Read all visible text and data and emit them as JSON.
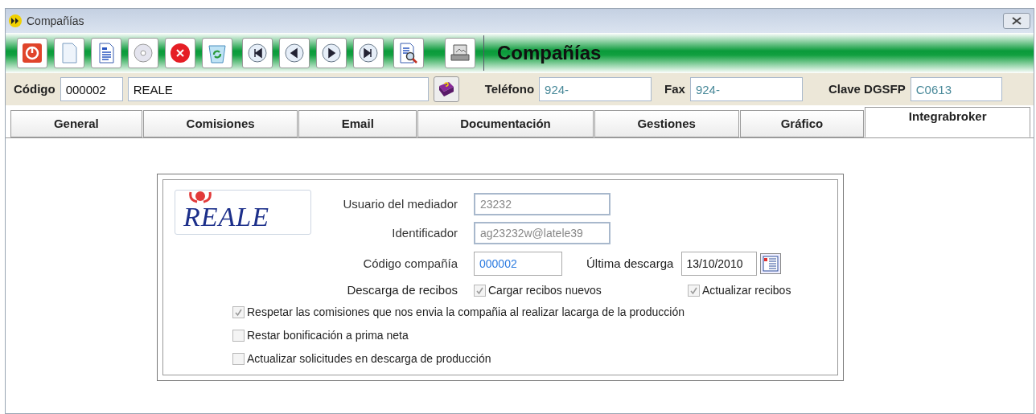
{
  "window": {
    "title": "Compañías"
  },
  "toolbar": {
    "buttons": [
      {
        "kind": "power"
      },
      {
        "kind": "new"
      },
      {
        "kind": "doc"
      },
      {
        "kind": "disc"
      },
      {
        "kind": "delete"
      },
      {
        "kind": "recycle"
      },
      {
        "kind": "first"
      },
      {
        "kind": "prev"
      },
      {
        "kind": "next"
      },
      {
        "kind": "last"
      },
      {
        "kind": "search"
      },
      {
        "kind": "print"
      }
    ],
    "title": "Compañías"
  },
  "header": {
    "fields": [
      {
        "label": "Código",
        "value": "000002",
        "kind": "code"
      },
      {
        "value": "REALE",
        "kind": "name"
      },
      {
        "label": "Teléfono",
        "value": "924-",
        "kind": "phone"
      },
      {
        "label": "Fax",
        "value": "924-",
        "kind": "fax"
      },
      {
        "label": "Clave DGSFP",
        "value": "C0613",
        "kind": "key"
      }
    ]
  },
  "tabs": [
    {
      "label": "General",
      "selected": false
    },
    {
      "label": "Comisiones",
      "selected": false
    },
    {
      "label": "Email",
      "selected": false
    },
    {
      "label": "Documentación",
      "selected": false
    },
    {
      "label": "Gestiones",
      "selected": false
    },
    {
      "label": "Gráfico",
      "selected": false
    },
    {
      "label": "Integrabroker",
      "selected": true
    }
  ],
  "panel": {
    "logo": "REALE",
    "usuario": {
      "label": "Usuario del mediador",
      "value": "23232",
      "disabled": true
    },
    "identificador": {
      "label": "Identificador",
      "value": "ag23232w@latele39",
      "disabled": true
    },
    "codigo": {
      "label": "Código compañía",
      "value": "000002"
    },
    "ultima": {
      "label": "Última descarga",
      "value": "13/10/2010"
    },
    "descarga_label": "Descarga de recibos",
    "checkboxes": [
      {
        "label": "Cargar recibos nuevos",
        "checked": true
      },
      {
        "label": "Actualizar recibos",
        "checked": true
      },
      {
        "label": "Respetar las comisiones que nos envia la compañia al realizar lacarga de la producción",
        "checked": true
      },
      {
        "label": "Restar bonificación a prima neta",
        "checked": false
      },
      {
        "label": "Actualizar solicitudes en descarga de producción",
        "checked": false
      }
    ]
  }
}
